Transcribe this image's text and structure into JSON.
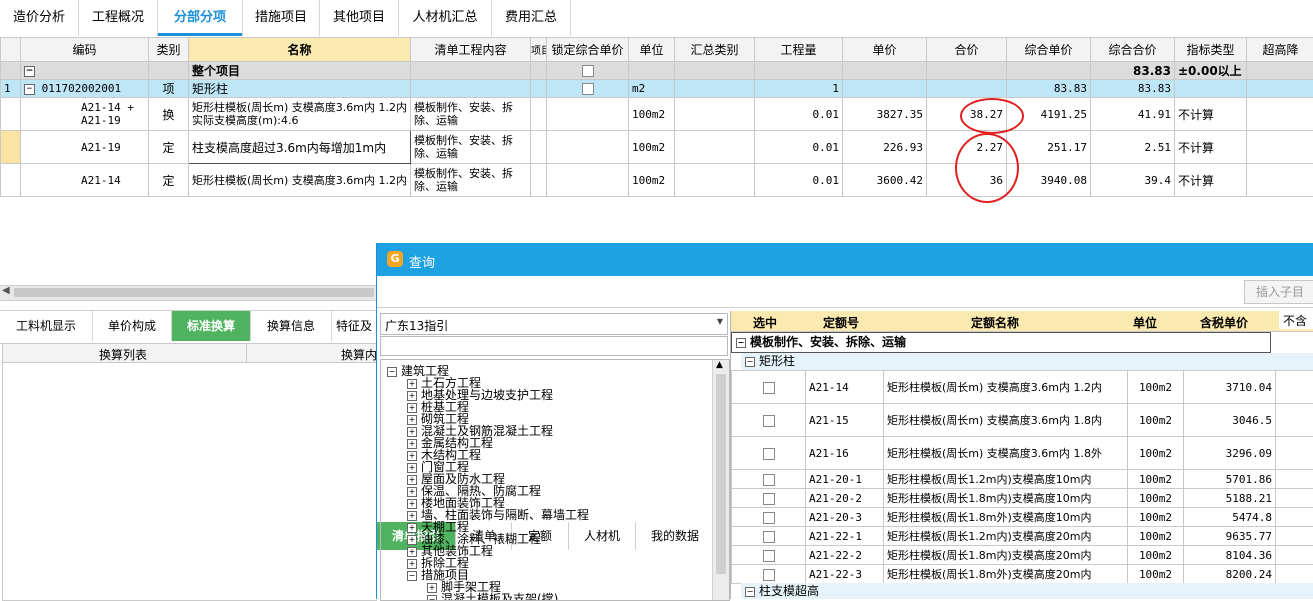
{
  "top_tabs": [
    "造价分析",
    "工程概况",
    "分部分项",
    "措施项目",
    "其他项目",
    "人材机汇总",
    "费用汇总"
  ],
  "columns": [
    "编码",
    "类别",
    "名称",
    "清单工程内容",
    "项目",
    "锁定综合单价",
    "单位",
    "汇总类别",
    "工程量",
    "单价",
    "合价",
    "综合单价",
    "综合合价",
    "指标类型",
    "超高降"
  ],
  "rows": [
    {
      "idx": "",
      "code": "",
      "type": "",
      "name": "整个项目",
      "content": "",
      "unit": "",
      "qty": "",
      "price": "",
      "total": "",
      "comp_price": "",
      "comp_total": "83.83",
      "index_type": "±0.00以上"
    },
    {
      "idx": "1",
      "code": "011702002001",
      "type": "项",
      "name": "矩形柱",
      "content": "",
      "unit": "m2",
      "qty": "1",
      "price": "",
      "total": "",
      "comp_price": "83.83",
      "comp_total": "83.83",
      "index_type": ""
    },
    {
      "idx": "",
      "code": "A21-14 + A21-19",
      "type": "换",
      "name": "矩形柱模板(周长m) 支模高度3.6m内 1.2内  实际支模高度(m):4.6",
      "content": "模板制作、安装、拆除、运输",
      "unit": "100m2",
      "qty": "0.01",
      "price": "3827.35",
      "total": "38.27",
      "comp_price": "4191.25",
      "comp_total": "41.91",
      "index_type": "不计算"
    },
    {
      "idx": "",
      "code": "A21-19",
      "type": "定",
      "name": "柱支模高度超过3.6m内每增加1m内",
      "content": "模板制作、安装、拆除、运输",
      "unit": "100m2",
      "qty": "0.01",
      "price": "226.93",
      "total": "2.27",
      "comp_price": "251.17",
      "comp_total": "2.51",
      "index_type": "不计算"
    },
    {
      "idx": "",
      "code": "A21-14",
      "type": "定",
      "name": "矩形柱模板(周长m) 支模高度3.6m内 1.2内",
      "content": "模板制作、安装、拆除、运输",
      "unit": "100m2",
      "qty": "0.01",
      "price": "3600.42",
      "total": "36",
      "comp_price": "3940.08",
      "comp_total": "39.4",
      "index_type": "不计算"
    }
  ],
  "bottom_tabs": [
    "工料机显示",
    "单价构成",
    "标准换算",
    "换算信息",
    "特征及"
  ],
  "bottom_headers": [
    "换算列表",
    "换算内"
  ],
  "dialog": {
    "title": "查询",
    "tabs": [
      "清单指引",
      "清单",
      "定额",
      "人材机",
      "我的数据"
    ],
    "insert_button": "插入子目",
    "province_select": "广东13指引",
    "tree_root": "建筑工程",
    "tree_items": [
      "土石方工程",
      "地基处理与边坡支护工程",
      "桩基工程",
      "砌筑工程",
      "混凝土及钢筋混凝土工程",
      "金属结构工程",
      "木结构工程",
      "门窗工程",
      "屋面及防水工程",
      "保温、隔热、防腐工程",
      "楼地面装饰工程",
      "墙、柱面装饰与隔断、幕墙工程",
      "天棚工程",
      "油漆、涂料、裱糊工程",
      "其他装饰工程",
      "拆除工程",
      "措施项目"
    ],
    "tree_sub": [
      "脚手架工程",
      "混凝土模板及支架(撑)"
    ],
    "result_headers": [
      "选中",
      "定额号",
      "定额名称",
      "单位",
      "含税单价",
      "不含"
    ],
    "group1": "模板制作、安装、拆除、运输",
    "group2": "矩形柱",
    "group3": "柱支模超高",
    "results": [
      {
        "code": "A21-14",
        "name": "矩形柱模板(周长m) 支模高度3.6m内 1.2内",
        "unit": "100m2",
        "price": "3710.04"
      },
      {
        "code": "A21-15",
        "name": "矩形柱模板(周长m) 支模高度3.6m内 1.8内",
        "unit": "100m2",
        "price": "3046.5"
      },
      {
        "code": "A21-16",
        "name": "矩形柱模板(周长m) 支模高度3.6m内 1.8外",
        "unit": "100m2",
        "price": "3296.09"
      },
      {
        "code": "A21-20-1",
        "name": "矩形柱模板(周长1.2m内)支模高度10m内",
        "unit": "100m2",
        "price": "5701.86"
      },
      {
        "code": "A21-20-2",
        "name": "矩形柱模板(周长1.8m内)支模高度10m内",
        "unit": "100m2",
        "price": "5188.21"
      },
      {
        "code": "A21-20-3",
        "name": "矩形柱模板(周长1.8m外)支模高度10m内",
        "unit": "100m2",
        "price": "5474.8"
      },
      {
        "code": "A21-22-1",
        "name": "矩形柱模板(周长1.2m内)支模高度20m内",
        "unit": "100m2",
        "price": "9635.77"
      },
      {
        "code": "A21-22-2",
        "name": "矩形柱模板(周长1.8m内)支模高度20m内",
        "unit": "100m2",
        "price": "8104.36"
      },
      {
        "code": "A21-22-3",
        "name": "矩形柱模板(周长1.8m外)支模高度20m内",
        "unit": "100m2",
        "price": "8200.24"
      }
    ]
  },
  "colors": {
    "accent": "#1e90d8",
    "green": "#4fb35f",
    "row_blue": "#bfe6f7",
    "header_yellow": "#fbeab0",
    "circle": "#e02020"
  }
}
